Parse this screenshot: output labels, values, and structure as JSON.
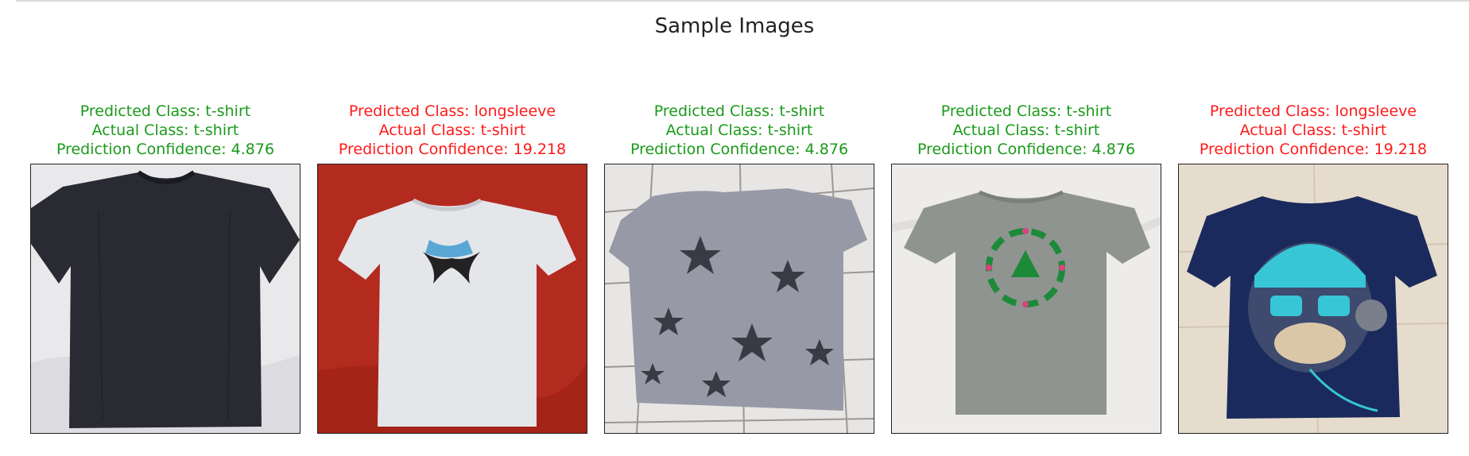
{
  "figure": {
    "title": "Sample Images"
  },
  "colors": {
    "correct": "#1a9a1a",
    "incorrect": "#ff1a1a"
  },
  "samples": [
    {
      "predicted": "Predicted Class: t-shirt",
      "actual": "Actual Class: t-shirt",
      "confidence": "Prediction Confidence: 4.876",
      "status": "correct",
      "image": "dark-navy-tshirt-on-white-sheet"
    },
    {
      "predicted": "Predicted Class: longsleeve",
      "actual": "Actual Class: t-shirt",
      "confidence": "Prediction Confidence: 19.218",
      "status": "incorrect",
      "image": "white-tshirt-logo-on-red-sheet"
    },
    {
      "predicted": "Predicted Class: t-shirt",
      "actual": "Actual Class: t-shirt",
      "confidence": "Prediction Confidence: 4.876",
      "status": "correct",
      "image": "grey-star-tshirt-on-tiles"
    },
    {
      "predicted": "Predicted Class: t-shirt",
      "actual": "Actual Class: t-shirt",
      "confidence": "Prediction Confidence: 4.876",
      "status": "correct",
      "image": "grey-tshirt-green-print-on-white"
    },
    {
      "predicted": "Predicted Class: longsleeve",
      "actual": "Actual Class: t-shirt",
      "confidence": "Prediction Confidence: 19.218",
      "status": "incorrect",
      "image": "navy-kids-tshirt-monkey-print"
    }
  ]
}
